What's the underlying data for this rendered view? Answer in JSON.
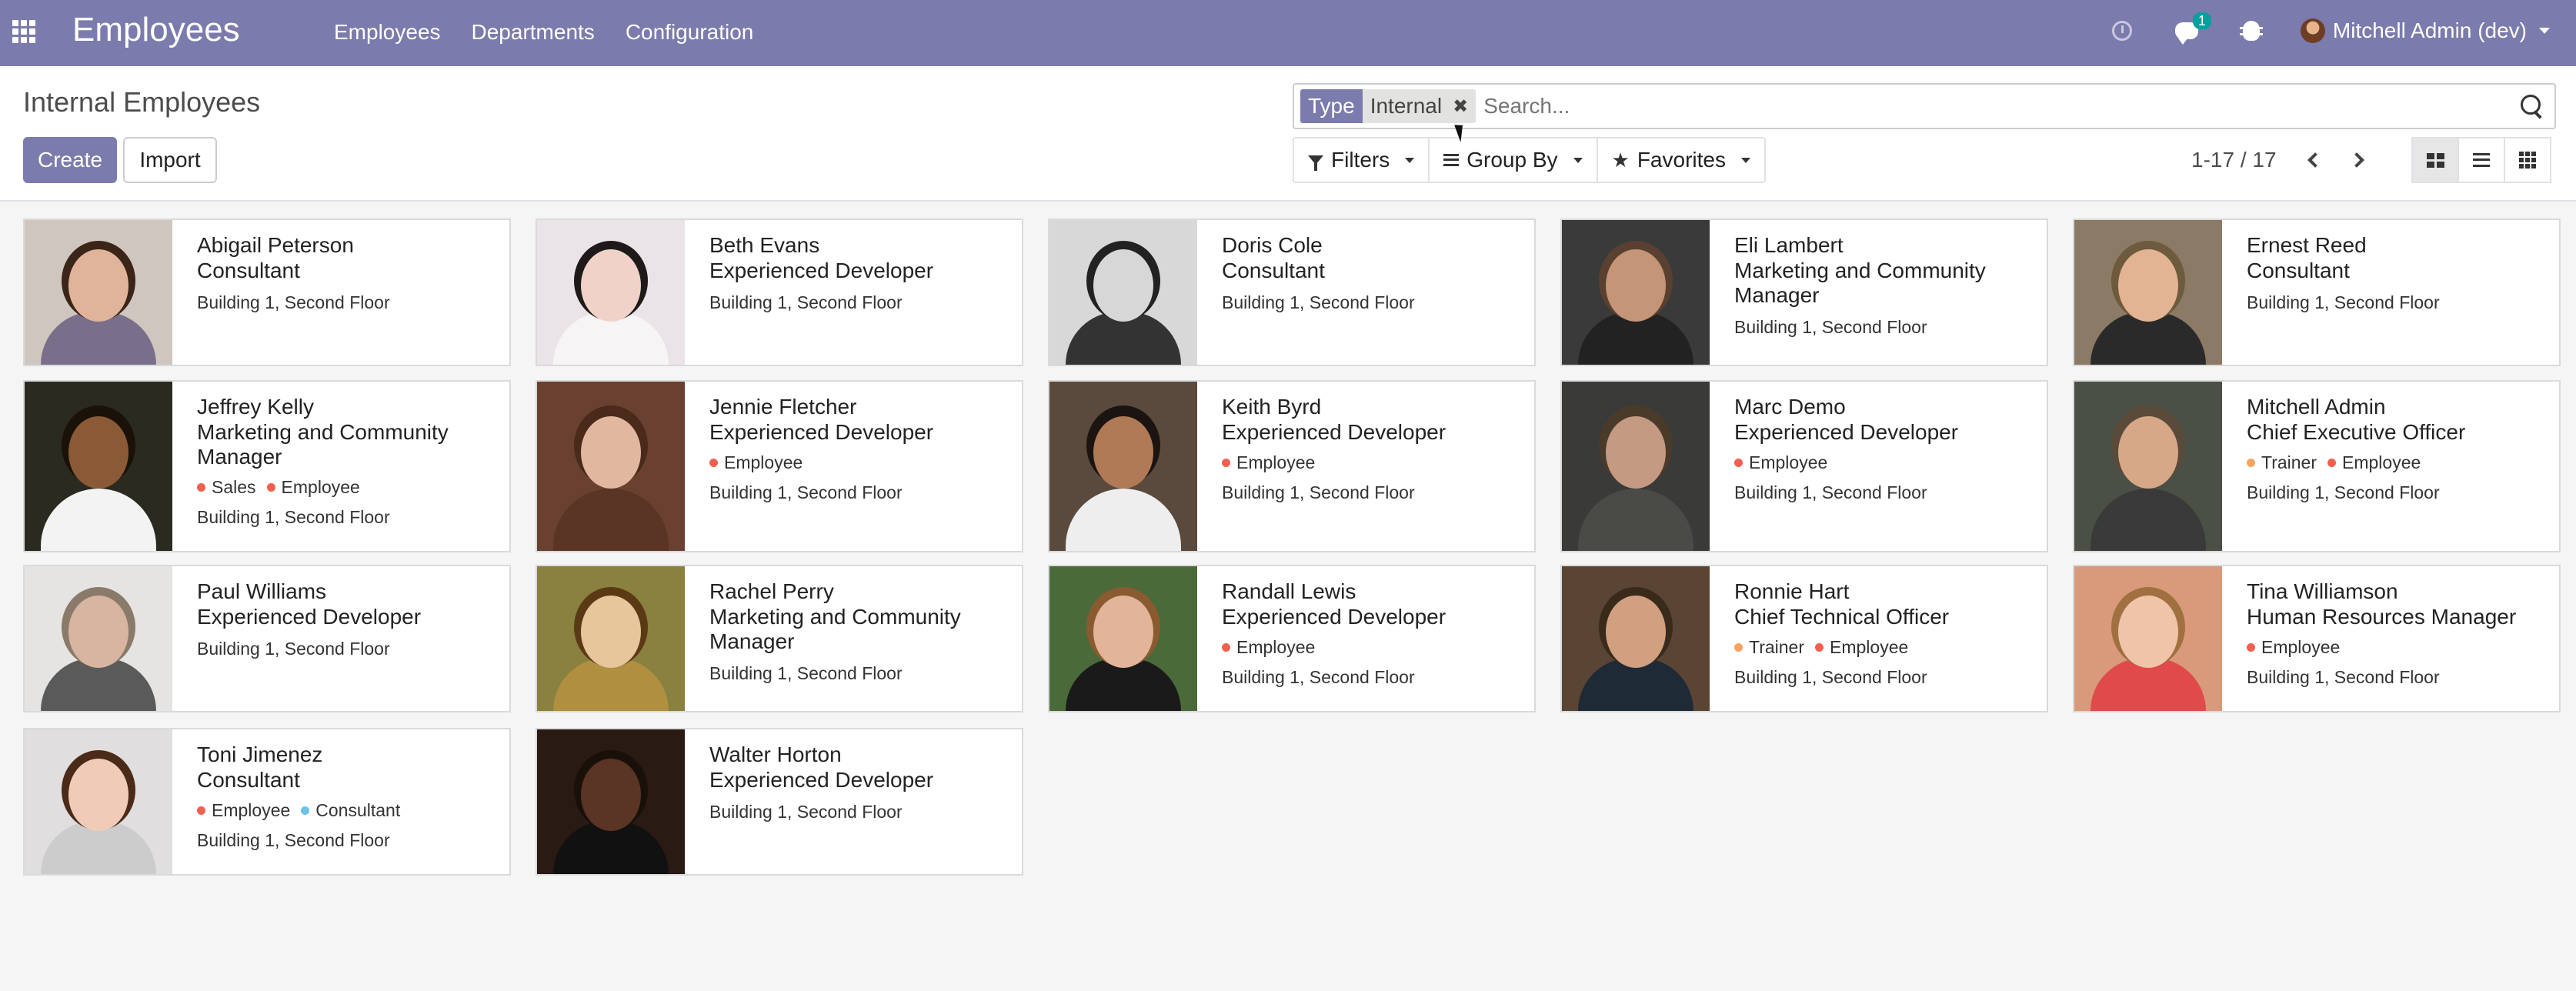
{
  "navbar": {
    "app_name": "Employees",
    "menu": [
      "Employees",
      "Departments",
      "Configuration"
    ],
    "chat_badge": "1",
    "user": "Mitchell Admin (dev)"
  },
  "control_panel": {
    "title": "Internal Employees",
    "create_label": "Create",
    "import_label": "Import",
    "search": {
      "facet_category": "Type",
      "facet_value": "Internal",
      "placeholder": "Search..."
    },
    "filters_label": "Filters",
    "groupby_label": "Group By",
    "favorites_label": "Favorites",
    "pager": "1-17 / 17"
  },
  "colors": {
    "brand": "#7c7bad",
    "tag_red": "#f06050",
    "tag_orange": "#f4a460",
    "tag_blue": "#6cc1ed"
  },
  "employees": [
    {
      "name": "Abigail Peterson",
      "job": "Consultant",
      "tags": [],
      "location": "Building 1, Second Floor"
    },
    {
      "name": "Beth Evans",
      "job": "Experienced Developer",
      "tags": [],
      "location": "Building 1, Second Floor"
    },
    {
      "name": "Doris Cole",
      "job": "Consultant",
      "tags": [],
      "location": "Building 1, Second Floor"
    },
    {
      "name": "Eli Lambert",
      "job": "Marketing and Community Manager",
      "tags": [],
      "location": "Building 1, Second Floor"
    },
    {
      "name": "Ernest Reed",
      "job": "Consultant",
      "tags": [],
      "location": "Building 1, Second Floor"
    },
    {
      "name": "Jeffrey Kelly",
      "job": "Marketing and Community Manager",
      "tags": [
        {
          "label": "Sales",
          "color": "#f06050"
        },
        {
          "label": "Employee",
          "color": "#f06050"
        }
      ],
      "location": "Building 1, Second Floor"
    },
    {
      "name": "Jennie Fletcher",
      "job": "Experienced Developer",
      "tags": [
        {
          "label": "Employee",
          "color": "#f06050"
        }
      ],
      "location": "Building 1, Second Floor"
    },
    {
      "name": "Keith Byrd",
      "job": "Experienced Developer",
      "tags": [
        {
          "label": "Employee",
          "color": "#f06050"
        }
      ],
      "location": "Building 1, Second Floor"
    },
    {
      "name": "Marc Demo",
      "job": "Experienced Developer",
      "tags": [
        {
          "label": "Employee",
          "color": "#f06050"
        }
      ],
      "location": "Building 1, Second Floor"
    },
    {
      "name": "Mitchell Admin",
      "job": "Chief Executive Officer",
      "tags": [
        {
          "label": "Trainer",
          "color": "#f4a460"
        },
        {
          "label": "Employee",
          "color": "#f06050"
        }
      ],
      "location": "Building 1, Second Floor"
    },
    {
      "name": "Paul Williams",
      "job": "Experienced Developer",
      "tags": [],
      "location": "Building 1, Second Floor"
    },
    {
      "name": "Rachel Perry",
      "job": "Marketing and Community Manager",
      "tags": [],
      "location": "Building 1, Second Floor"
    },
    {
      "name": "Randall Lewis",
      "job": "Experienced Developer",
      "tags": [
        {
          "label": "Employee",
          "color": "#f06050"
        }
      ],
      "location": "Building 1, Second Floor"
    },
    {
      "name": "Ronnie Hart",
      "job": "Chief Technical Officer",
      "tags": [
        {
          "label": "Trainer",
          "color": "#f4a460"
        },
        {
          "label": "Employee",
          "color": "#f06050"
        }
      ],
      "location": "Building 1, Second Floor"
    },
    {
      "name": "Tina Williamson",
      "job": "Human Resources Manager",
      "tags": [
        {
          "label": "Employee",
          "color": "#f06050"
        }
      ],
      "location": "Building 1, Second Floor"
    },
    {
      "name": "Toni Jimenez",
      "job": "Consultant",
      "tags": [
        {
          "label": "Employee",
          "color": "#f06050"
        },
        {
          "label": "Consultant",
          "color": "#6cc1ed"
        }
      ],
      "location": "Building 1, Second Floor"
    },
    {
      "name": "Walter Horton",
      "job": "Experienced Developer",
      "tags": [],
      "location": "Building 1, Second Floor"
    }
  ]
}
